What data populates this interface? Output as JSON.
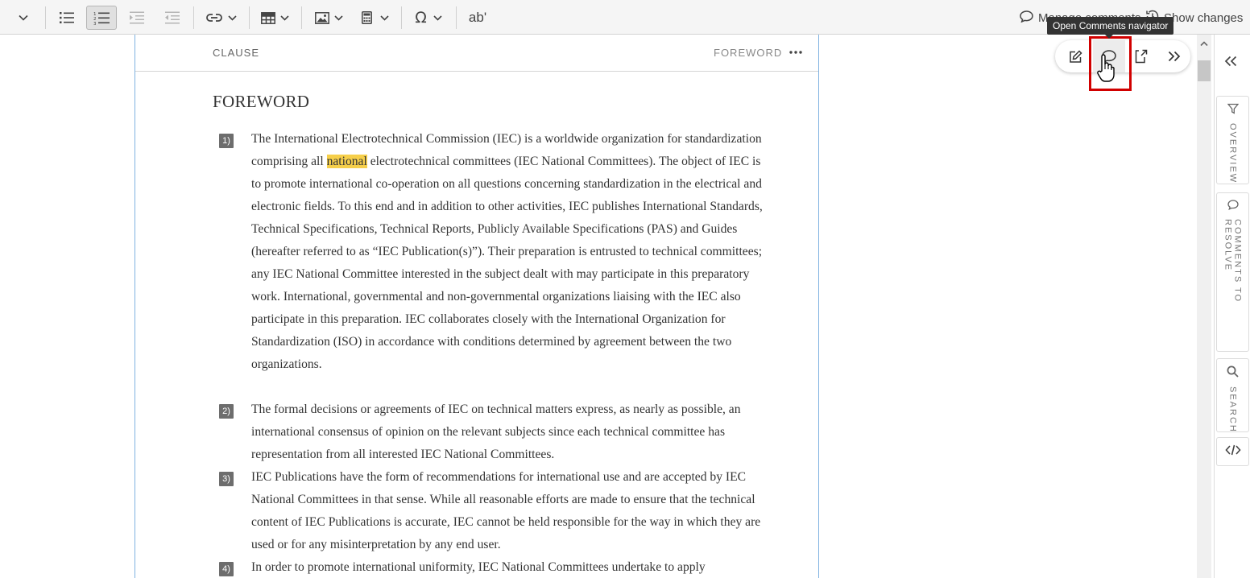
{
  "toolbar": {
    "manage_comments_label": "Manage comments",
    "show_changes_label": "Show changes",
    "special_char_symbol": "Ω",
    "spellcheck_label": "ab'"
  },
  "tooltip": {
    "text": "Open Comments navigator"
  },
  "document": {
    "clause_label": "CLAUSE",
    "section_label": "FOREWORD",
    "title": "FOREWORD",
    "paragraphs": [
      {
        "number": "1)",
        "before_highlight": "The International Electrotechnical Commission (IEC) is a worldwide organization for standardization comprising all ",
        "highlight": "national",
        "after_highlight": " electrotechnical committees (IEC National Committees). The object of IEC is to promote international co-operation on all questions concerning standardization in the electrical and electronic fields. To this end and in addition to other activities, IEC publishes International Standards, Technical Specifications, Technical Reports, Publicly Available Specifications (PAS) and Guides (hereafter referred to as “IEC Publication(s)”). Their preparation is entrusted to technical committees; any IEC National Committee interested in the subject dealt with may participate in this preparatory work. International, governmental and non-governmental organizations liaising with the IEC also participate in this preparation. IEC collaborates closely with the International Organization for Standardization (ISO) in accordance with conditions determined by agreement between the two organizations."
      },
      {
        "number": "2)",
        "text": "The formal decisions or agreements of IEC on technical matters express, as nearly as possible, an international consensus of opinion on the relevant subjects since each technical committee has representation from all interested IEC National Committees."
      },
      {
        "number": "3)",
        "text": "IEC Publications have the form of recommendations for international use and are accepted by IEC National Committees in that sense. While all reasonable efforts are made to ensure that the technical content of IEC Publications is accurate, IEC cannot be held responsible for the way in which they are used or for any misinterpretation by any end user."
      },
      {
        "number": "4)",
        "text": "In order to promote international uniformity, IEC National Committees undertake to apply"
      }
    ]
  },
  "float_bar": {
    "icons": [
      "edit-icon",
      "comment-icon",
      "export-icon",
      "expand-icon"
    ]
  },
  "rail": {
    "overview_label": "OVERVIEW",
    "comments_label": "COMMENTS TO RESOLVE",
    "search_label": "SEARCH"
  },
  "colors": {
    "highlight": "#f6cf4a",
    "annotation_box": "#d10000",
    "doc_border": "#7fb2e0"
  }
}
